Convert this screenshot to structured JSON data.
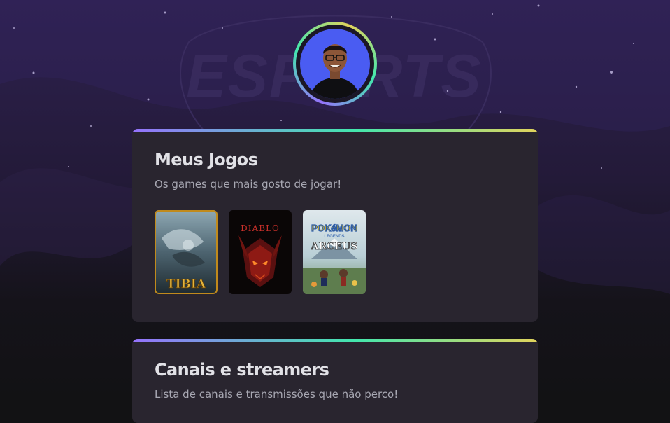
{
  "background": {
    "logo_text": "ESPORTS"
  },
  "profile": {
    "avatar_icon": "user-photo"
  },
  "games_section": {
    "title": "Meus Jogos",
    "subtitle": "Os games que mais gosto de jogar!",
    "games": [
      {
        "name": "Tibia",
        "cover_text": "TIBIA"
      },
      {
        "name": "Diablo",
        "cover_text": "DIABLO"
      },
      {
        "name": "Pokémon Legends Arceus",
        "cover_text_top": "POKéMON",
        "cover_text_mid": "LEGENDS",
        "cover_text_bottom": "ARCEUS"
      }
    ]
  },
  "streams_section": {
    "title": "Canais e streamers",
    "subtitle": "Lista de canais e transmissões que não perco!"
  },
  "colors": {
    "gradient_start": "#9572fc",
    "gradient_mid": "#43e7ad",
    "gradient_end": "#e2d45c",
    "card_bg": "#29252f",
    "page_bg": "#121214"
  }
}
